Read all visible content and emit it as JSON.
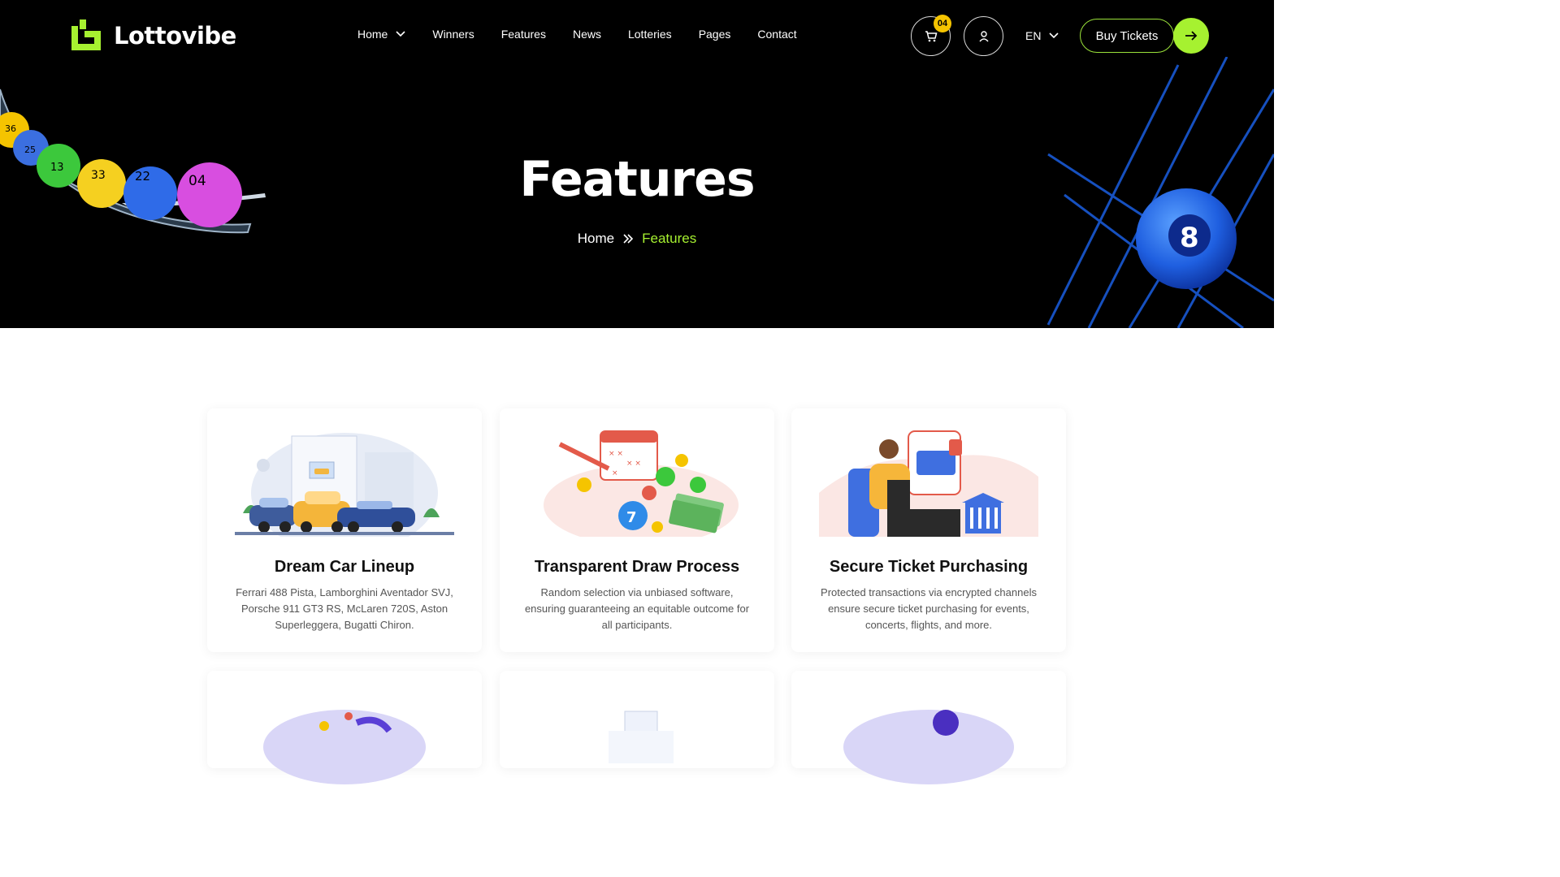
{
  "brand": {
    "name": "Lottovibe",
    "accent": "#a6f130",
    "badge_color": "#f5c400"
  },
  "nav": {
    "items": [
      {
        "label": "Home",
        "has_dropdown": true
      },
      {
        "label": "Winners"
      },
      {
        "label": "Features"
      },
      {
        "label": "News"
      },
      {
        "label": "Lotteries"
      },
      {
        "label": "Pages"
      },
      {
        "label": "Contact"
      }
    ],
    "cart_count": "04",
    "language": "EN",
    "buy_label": "Buy Tickets"
  },
  "hero": {
    "title": "Features",
    "breadcrumb": {
      "home": "Home",
      "current": "Features"
    },
    "ball_numbers": [
      "36",
      "25",
      "13",
      "33",
      "22",
      "04"
    ],
    "eight_ball": "8"
  },
  "cards": [
    {
      "title": "Dream Car Lineup",
      "description": "Ferrari 488 Pista, Lamborghini Aventador SVJ, Porsche 911 GT3 RS, McLaren 720S, Aston Superleggera, Bugatti Chiron.",
      "illustration": "cars-showroom-illustration"
    },
    {
      "title": "Transparent Draw Process",
      "description": "Random selection via unbiased software, ensuring guaranteeing an equitable outcome for all participants.",
      "illustration": "lottery-draw-illustration"
    },
    {
      "title": "Secure Ticket Purchasing",
      "description": "Protected transactions via encrypted channels ensure secure ticket purchasing for events, concerts, flights, and more.",
      "illustration": "secure-payment-illustration"
    }
  ]
}
